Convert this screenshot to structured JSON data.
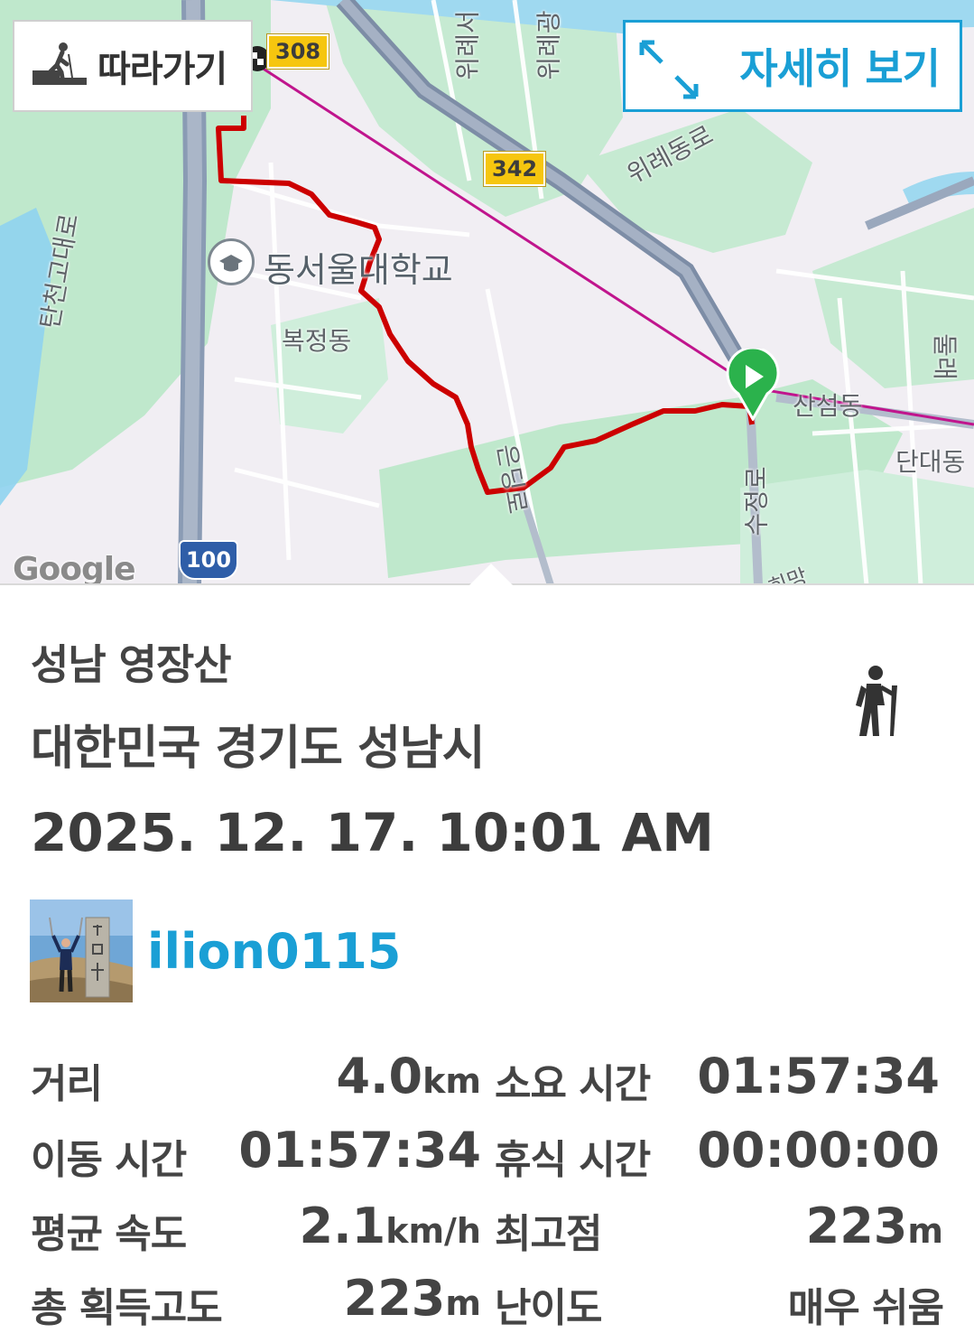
{
  "map": {
    "follow_label": "따라가기",
    "detail_label": "자세히 보기",
    "labels": {
      "university": "동서울대학교",
      "bokjeong": "복정동",
      "sanseong": "산섬동",
      "dandae": "단대동",
      "wirye_dongro": "위례동로",
      "tancheon": "탄천고대로",
      "wirye_a": "위례서",
      "wirye_b": "위례광",
      "sujeong": "수정로",
      "eunmaek": "은딩로",
      "right_edge": "둘래",
      "bottom": "희망"
    },
    "shields": {
      "r308": "308",
      "r342": "342",
      "r100": "100"
    },
    "google": "Google",
    "colors": {
      "route": "#cc0000",
      "straight": "#c0158d",
      "road": "#8a9bb4",
      "park": "#bfe8cc",
      "water": "#8fd3ef"
    }
  },
  "activity": {
    "title": "성남 영장산",
    "location": "대한민국 경기도 성남시",
    "datetime": "2025. 12. 17. 10:01 AM",
    "type_icon": "hiker-icon"
  },
  "user": {
    "name": "ilion0115",
    "avatar_icon": "profile-photo"
  },
  "stats": {
    "distance_label": "거리",
    "distance_value": "4.0",
    "distance_unit": "km",
    "duration_label": "소요 시간",
    "duration_value": "01:57:34",
    "moving_label": "이동 시간",
    "moving_value": "01:57:34",
    "rest_label": "휴식 시간",
    "rest_value": "00:00:00",
    "speed_label": "평균 속도",
    "speed_value": "2.1",
    "speed_unit": "km/h",
    "max_alt_label": "최고점",
    "max_alt_value": "223",
    "max_alt_unit": "m",
    "gain_label": "총 획득고도",
    "gain_value": "223",
    "gain_unit": "m",
    "difficulty_label": "난이도",
    "difficulty_value": "매우 쉬움"
  }
}
